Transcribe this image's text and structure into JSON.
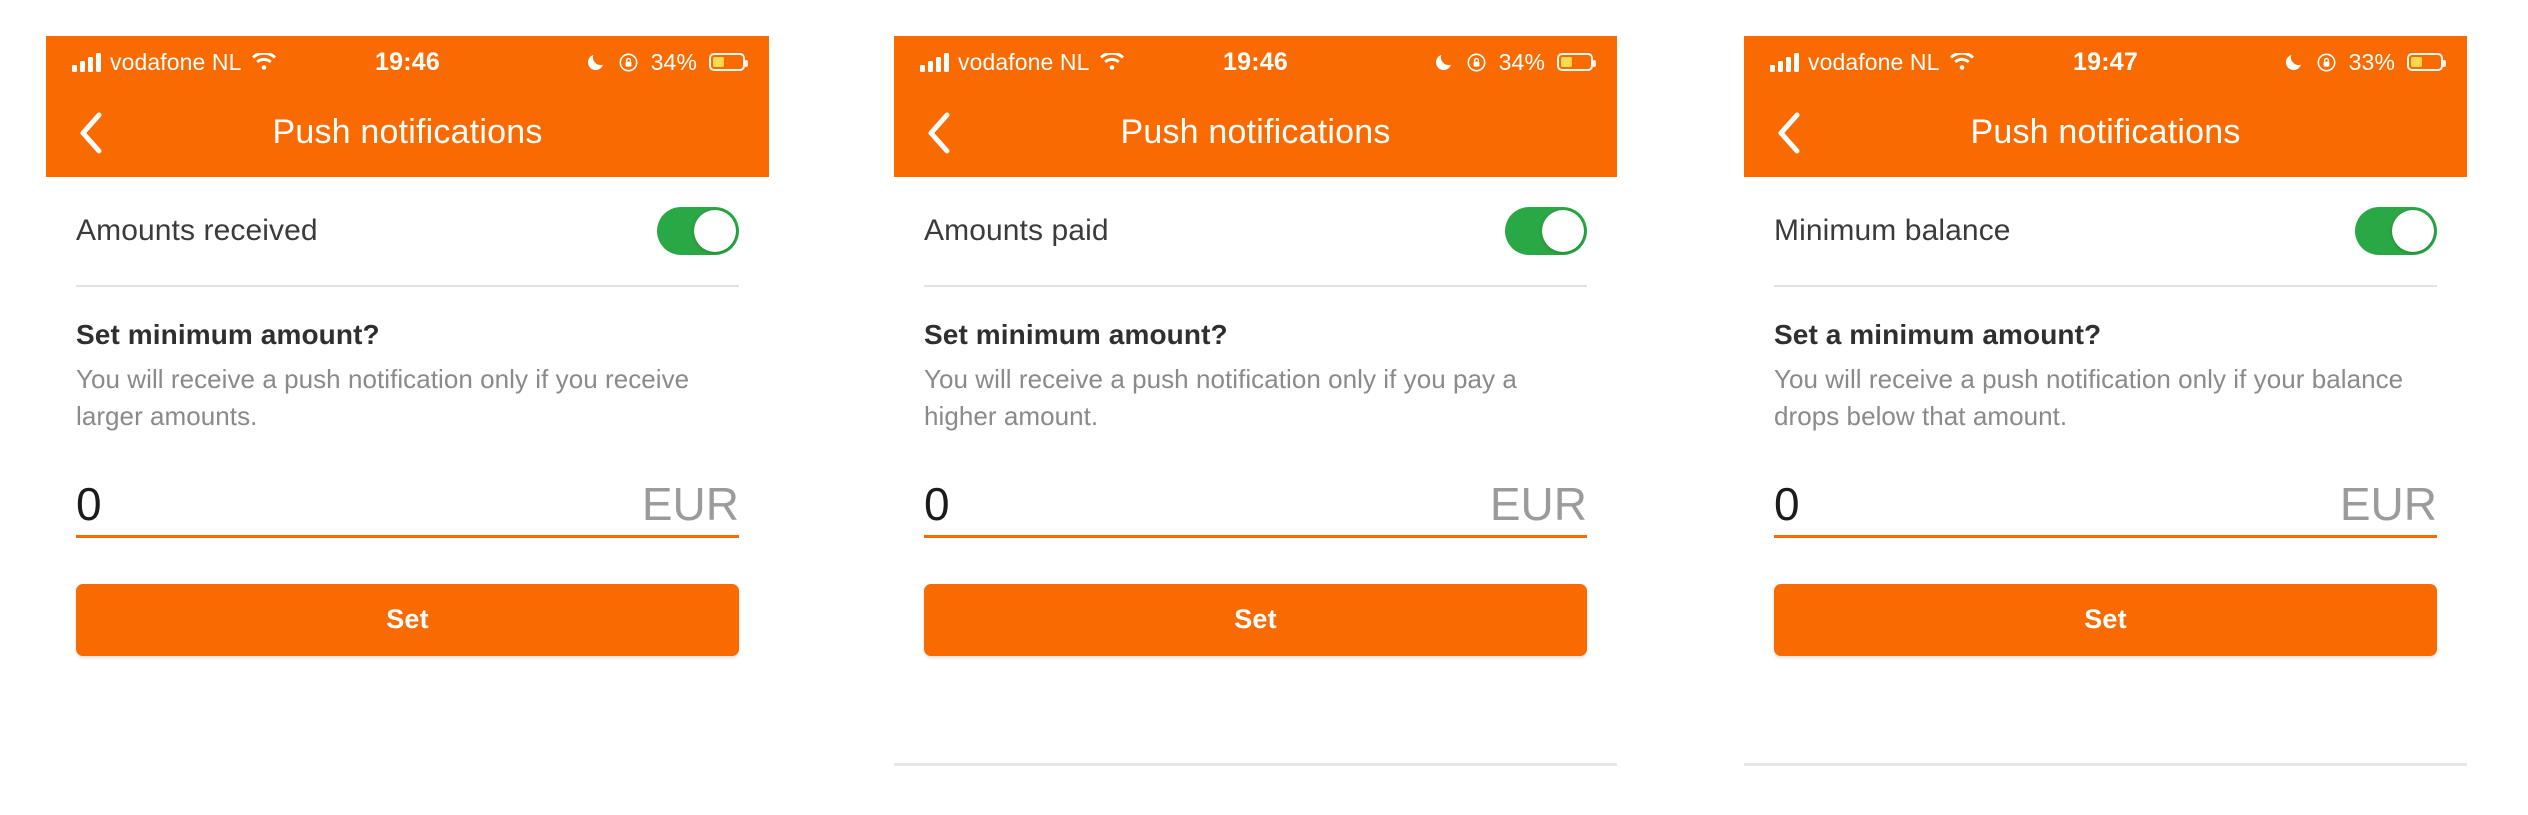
{
  "panels": [
    {
      "status": {
        "carrier": "vodafone NL",
        "time": "19:46",
        "battery_percent": "34%",
        "battery_level": 34,
        "signal_icon": "signal-bars-icon",
        "wifi_icon": "wifi-icon",
        "moon_icon": "do-not-disturb-moon-icon",
        "rotation_lock_icon": "rotation-lock-icon",
        "battery_icon": "battery-icon"
      },
      "nav": {
        "back_icon": "chevron-left-icon",
        "title": "Push notifications"
      },
      "toggle": {
        "label": "Amounts received",
        "state": "on"
      },
      "section": {
        "title": "Set minimum amount?",
        "description": "You will receive a push notification only if you receive larger amounts."
      },
      "amount": {
        "value": "0",
        "placeholder": "0",
        "currency": "EUR"
      },
      "submit": {
        "label": "Set"
      }
    },
    {
      "status": {
        "carrier": "vodafone NL",
        "time": "19:46",
        "battery_percent": "34%",
        "battery_level": 34,
        "signal_icon": "signal-bars-icon",
        "wifi_icon": "wifi-icon",
        "moon_icon": "do-not-disturb-moon-icon",
        "rotation_lock_icon": "rotation-lock-icon",
        "battery_icon": "battery-icon"
      },
      "nav": {
        "back_icon": "chevron-left-icon",
        "title": "Push notifications"
      },
      "toggle": {
        "label": "Amounts paid",
        "state": "on"
      },
      "section": {
        "title": "Set minimum amount?",
        "description": "You will receive a push notification only if you pay a higher amount."
      },
      "amount": {
        "value": "0",
        "placeholder": "0",
        "currency": "EUR"
      },
      "submit": {
        "label": "Set"
      }
    },
    {
      "status": {
        "carrier": "vodafone NL",
        "time": "19:47",
        "battery_percent": "33%",
        "battery_level": 33,
        "signal_icon": "signal-bars-icon",
        "wifi_icon": "wifi-icon",
        "moon_icon": "do-not-disturb-moon-icon",
        "rotation_lock_icon": "rotation-lock-icon",
        "battery_icon": "battery-icon"
      },
      "nav": {
        "back_icon": "chevron-left-icon",
        "title": "Push notifications"
      },
      "toggle": {
        "label": "Minimum balance",
        "state": "on"
      },
      "section": {
        "title": "Set a minimum amount?",
        "description": "You will receive a push notification only if your balance drops below that amount."
      },
      "amount": {
        "value": "0",
        "placeholder": "0",
        "currency": "EUR"
      },
      "submit": {
        "label": "Set"
      }
    }
  ],
  "colors": {
    "brand_orange": "#f96a00",
    "toggle_green": "#2aa845",
    "battery_yellow": "#ffd84d",
    "text_dark": "#3b3b3b",
    "text_muted": "#8a8a8a"
  }
}
